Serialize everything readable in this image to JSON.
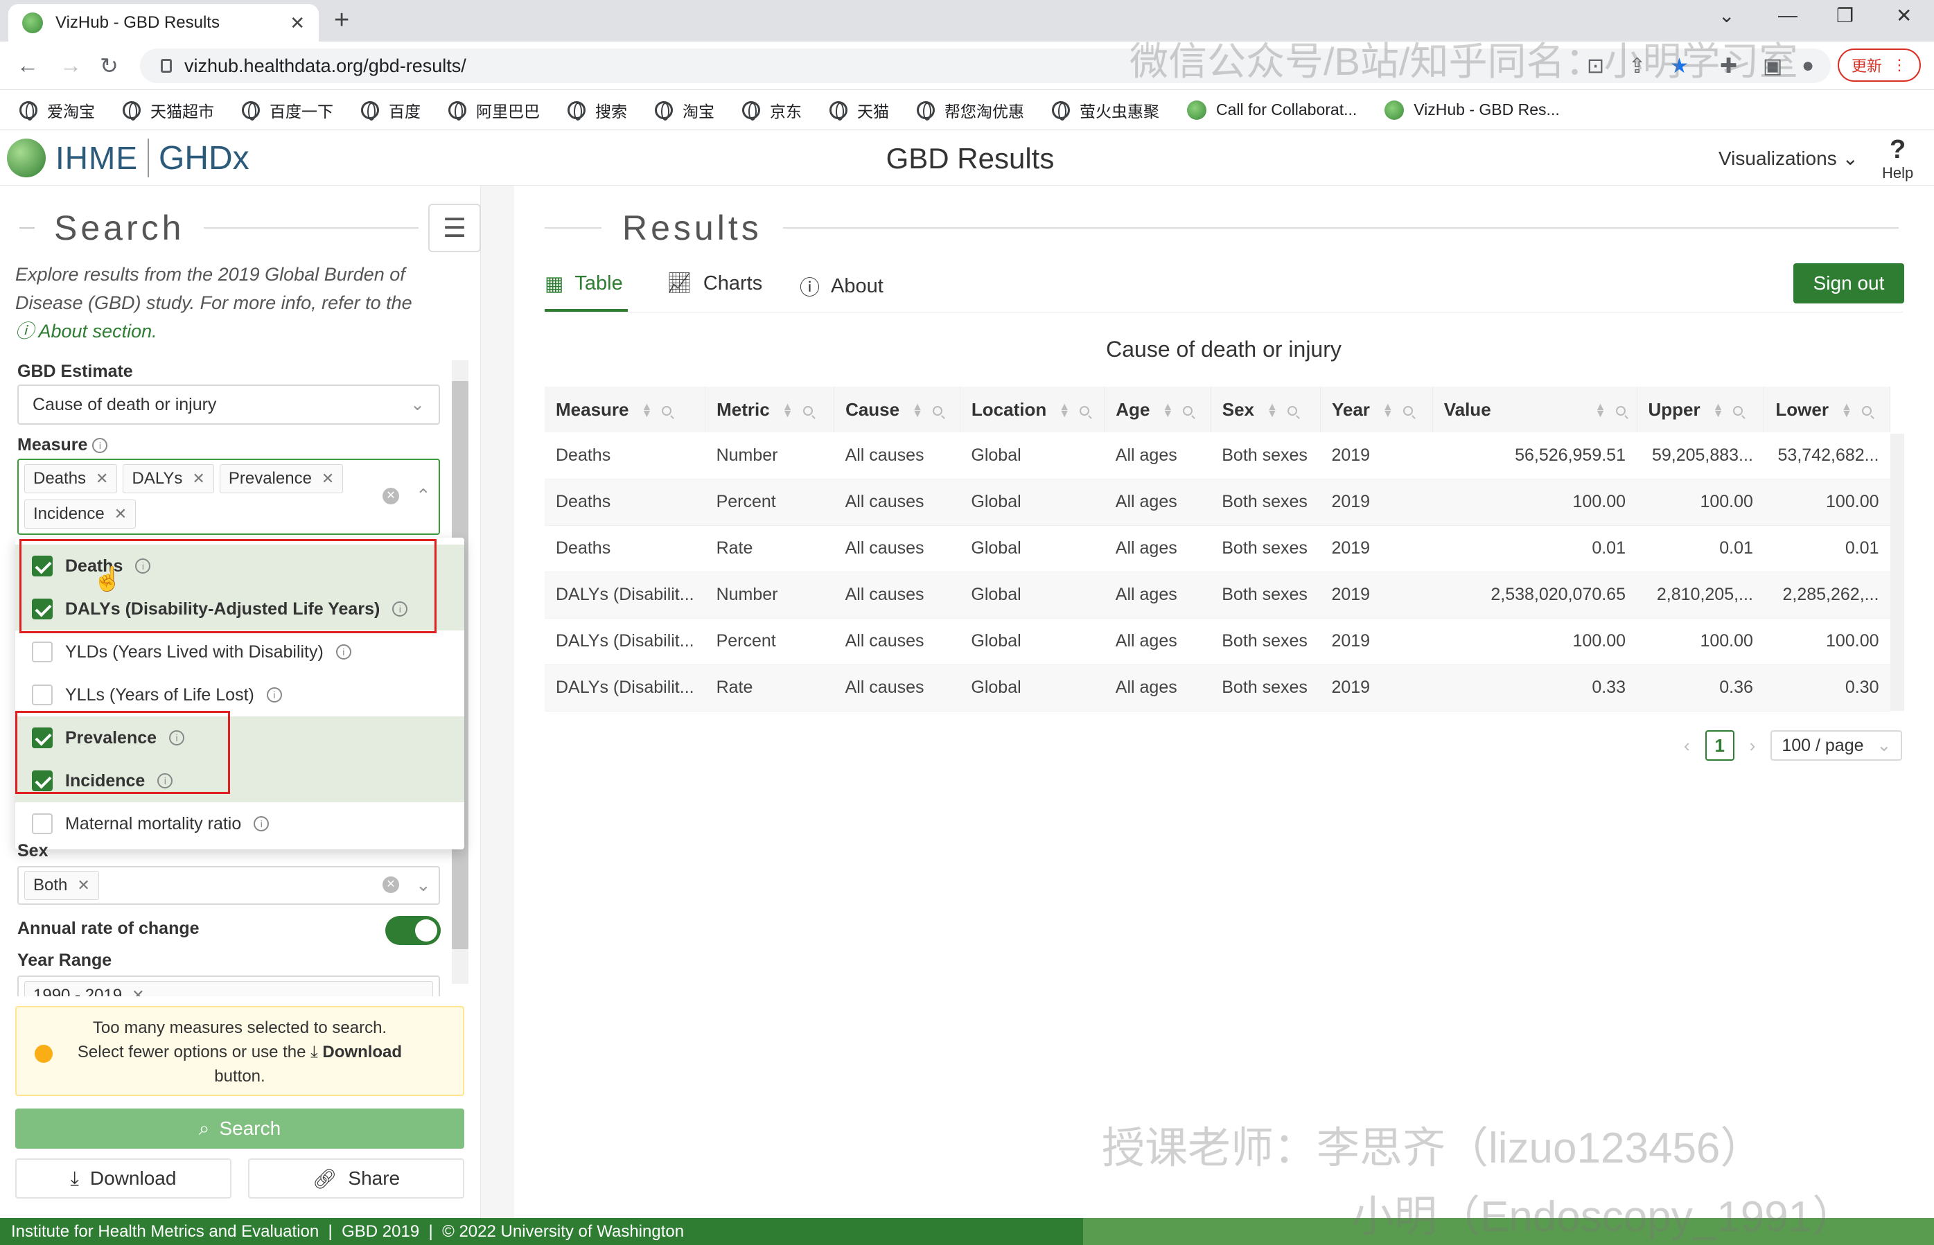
{
  "browser": {
    "tab_title": "VizHub - GBD Results",
    "url": "vizhub.healthdata.org/gbd-results/",
    "update_label": "更新",
    "bookmarks": [
      "爱淘宝",
      "天猫超市",
      "百度一下",
      "百度",
      "阿里巴巴",
      "搜索",
      "淘宝",
      "京东",
      "天猫",
      "帮您淘优惠",
      "萤火虫惠聚",
      "Call for Collaborat...",
      "VizHub - GBD Res..."
    ]
  },
  "header": {
    "logo_ihme": "IHME",
    "logo_ghdx": "GHDx",
    "title": "GBD Results",
    "visualizations": "Visualizations",
    "help": "Help"
  },
  "search": {
    "heading": "Search",
    "intro": "Explore results from the 2019 Global Burden of Disease (GBD) study. For more info, refer to the",
    "about_link": "About section.",
    "gbd_estimate_label": "GBD Estimate",
    "gbd_estimate_value": "Cause of death or injury",
    "measure_label": "Measure",
    "measure_tags": [
      "Deaths",
      "DALYs",
      "Prevalence",
      "Incidence"
    ],
    "measure_options": [
      {
        "label": "Deaths",
        "checked": true
      },
      {
        "label": "DALYs (Disability-Adjusted Life Years)",
        "checked": true
      },
      {
        "label": "YLDs (Years Lived with Disability)",
        "checked": false
      },
      {
        "label": "YLLs (Years of Life Lost)",
        "checked": false
      },
      {
        "label": "Prevalence",
        "checked": true
      },
      {
        "label": "Incidence",
        "checked": true
      },
      {
        "label": "Maternal mortality ratio",
        "checked": false
      }
    ],
    "sex_label": "Sex",
    "sex_tag": "Both",
    "annual_rate_label": "Annual rate of change",
    "annual_rate_on": true,
    "year_range_label": "Year Range",
    "year_range_tag": "1990 - 2019",
    "warning_line1": "Too many measures selected to search.",
    "warning_line2": "Select fewer options or use the",
    "warning_download": "Download",
    "warning_line3": "button.",
    "search_button": "Search",
    "download_button": "Download",
    "share_button": "Share"
  },
  "results": {
    "heading": "Results",
    "tabs": [
      "Table",
      "Charts",
      "About"
    ],
    "active_tab": "Table",
    "sign_out": "Sign out",
    "table_title": "Cause of death or injury",
    "columns": [
      "Measure",
      "Metric",
      "Cause",
      "Location",
      "Age",
      "Sex",
      "Year",
      "Value",
      "Upper",
      "Lower"
    ],
    "rows": [
      [
        "Deaths",
        "Number",
        "All causes",
        "Global",
        "All ages",
        "Both sexes",
        "2019",
        "56,526,959.51",
        "59,205,883...",
        "53,742,682..."
      ],
      [
        "Deaths",
        "Percent",
        "All causes",
        "Global",
        "All ages",
        "Both sexes",
        "2019",
        "100.00",
        "100.00",
        "100.00"
      ],
      [
        "Deaths",
        "Rate",
        "All causes",
        "Global",
        "All ages",
        "Both sexes",
        "2019",
        "0.01",
        "0.01",
        "0.01"
      ],
      [
        "DALYs (Disabilit...",
        "Number",
        "All causes",
        "Global",
        "All ages",
        "Both sexes",
        "2019",
        "2,538,020,070.65",
        "2,810,205,...",
        "2,285,262,..."
      ],
      [
        "DALYs (Disabilit...",
        "Percent",
        "All causes",
        "Global",
        "All ages",
        "Both sexes",
        "2019",
        "100.00",
        "100.00",
        "100.00"
      ],
      [
        "DALYs (Disabilit...",
        "Rate",
        "All causes",
        "Global",
        "All ages",
        "Both sexes",
        "2019",
        "0.33",
        "0.36",
        "0.30"
      ]
    ],
    "page": "1",
    "page_size": "100 / page"
  },
  "footer": {
    "text": "Institute for Health Metrics and Evaluation  |  GBD 2019  |  © 2022 University of Washington"
  },
  "watermarks": {
    "top": "微信公众号/B站/知乎同名：小明学习室",
    "bottom1": "授课老师：李思齐（lizuo123456）",
    "bottom2": "小明（Endoscopy_1991）"
  },
  "colors": {
    "brand_green": "#2e7d32",
    "highlight_red": "#e02020",
    "warning_yellow": "#faad14"
  }
}
